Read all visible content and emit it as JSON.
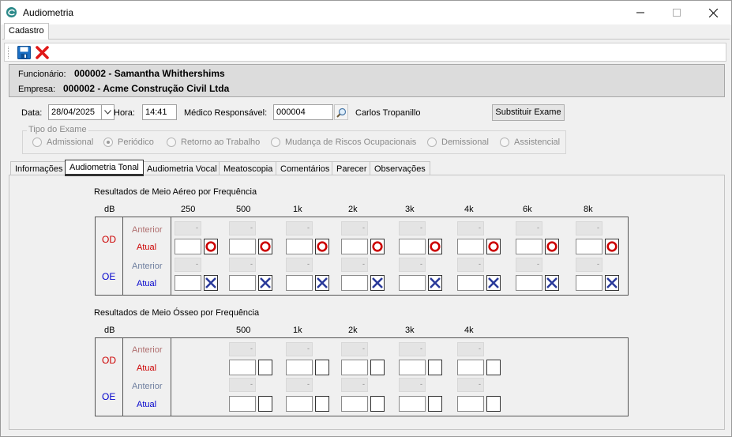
{
  "window": {
    "title": "Audiometria"
  },
  "top_tabs": [
    "Cadastro"
  ],
  "header": {
    "funcionario_label": "Funcionário:",
    "funcionario_value": "000002 - Samantha Whithershims",
    "empresa_label": "Empresa:",
    "empresa_value": "000002 - Acme Construção Civil Ltda"
  },
  "form": {
    "data_label": "Data:",
    "data_value": "28/04/2025",
    "hora_label": "Hora:",
    "hora_value": "14:41",
    "medico_label": "Médico Responsável:",
    "medico_code": "000004",
    "medico_name": "Carlos Tropanillo",
    "substituir_button": "Substituir Exame"
  },
  "tipo_exame": {
    "title": "Tipo do Exame",
    "options": [
      "Admissional",
      "Periódico",
      "Retorno ao Trabalho",
      "Mudança de Riscos Ocupacionais",
      "Demissional",
      "Assistencial"
    ],
    "selected": "Periódico"
  },
  "tabs": [
    "Informações",
    "Audiometria Tonal",
    "Audiometria Vocal",
    "Meatoscopia",
    "Comentários",
    "Parecer",
    "Observações"
  ],
  "active_tab": "Audiometria Tonal",
  "aereo": {
    "title": "Resultados de Meio Aéreo por Frequência",
    "db_label": "dB",
    "frequencies": [
      "250",
      "500",
      "1k",
      "2k",
      "3k",
      "4k",
      "6k",
      "8k"
    ],
    "od_label": "OD",
    "oe_label": "OE",
    "anterior_label": "Anterior",
    "atual_label": "Atual",
    "anterior_placeholder": "-"
  },
  "osseo": {
    "title": "Resultados de Meio Ósseo por Frequência",
    "db_label": "dB",
    "frequencies": [
      "500",
      "1k",
      "2k",
      "3k",
      "4k"
    ],
    "od_label": "OD",
    "oe_label": "OE",
    "anterior_label": "Anterior",
    "atual_label": "Atual",
    "anterior_placeholder": "-"
  },
  "colors": {
    "od_symbol": "#cc0000",
    "oe_symbol": "#2a3a9a",
    "save_icon": "#1a6fc4",
    "delete_icon": "#e01818"
  },
  "icons": {
    "app": "app-logo-icon",
    "save": "save-icon",
    "delete": "delete-icon",
    "search": "magnifier-icon",
    "od_mark": "circle-icon",
    "oe_mark": "x-cross-icon"
  }
}
